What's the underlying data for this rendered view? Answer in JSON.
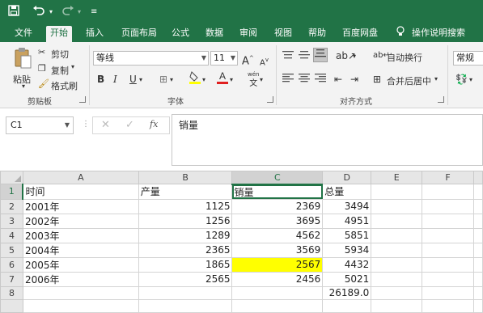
{
  "colors": {
    "brand": "#217346",
    "highlight": "#ffff00"
  },
  "titlebar": {
    "icons": [
      "save-icon",
      "undo-icon",
      "redo-icon",
      "customize-icon"
    ]
  },
  "tabs": [
    "文件",
    "开始",
    "插入",
    "页面布局",
    "公式",
    "数据",
    "审阅",
    "视图",
    "帮助",
    "百度网盘",
    "操作说明搜索"
  ],
  "ribbon": {
    "clipboard": {
      "paste": "粘贴",
      "cut": "剪切",
      "copy": "复制",
      "format_painter": "格式刷",
      "label": "剪贴板"
    },
    "font": {
      "name": "等线",
      "size": "11",
      "grow": "A",
      "shrink": "A",
      "bold": "B",
      "italic": "I",
      "underline": "U",
      "phonetic": "wén",
      "label": "字体"
    },
    "alignment": {
      "wrap": "自动换行",
      "merge": "合并后居中",
      "label": "对齐方式"
    },
    "number": {
      "format": "常规"
    }
  },
  "formula": {
    "name_box": "C1",
    "content": "销量",
    "fx": "fx"
  },
  "sheet": {
    "columns": [
      "A",
      "B",
      "C",
      "D",
      "E",
      "F"
    ],
    "rows": [
      {
        "n": "1",
        "cells": [
          "时间",
          "产量",
          "销量",
          "总量",
          "",
          ""
        ]
      },
      {
        "n": "2",
        "cells": [
          "2001年",
          "1125",
          "2369",
          "3494",
          "",
          ""
        ]
      },
      {
        "n": "3",
        "cells": [
          "2002年",
          "1256",
          "3695",
          "4951",
          "",
          ""
        ]
      },
      {
        "n": "4",
        "cells": [
          "2003年",
          "1289",
          "4562",
          "5851",
          "",
          ""
        ]
      },
      {
        "n": "5",
        "cells": [
          "2004年",
          "2365",
          "3569",
          "5934",
          "",
          ""
        ]
      },
      {
        "n": "6",
        "cells": [
          "2005年",
          "1865",
          "2567",
          "4432",
          "",
          ""
        ]
      },
      {
        "n": "7",
        "cells": [
          "2006年",
          "2565",
          "2456",
          "5021",
          "",
          ""
        ]
      },
      {
        "n": "8",
        "cells": [
          "",
          "",
          "",
          "26189.0",
          "",
          ""
        ]
      }
    ]
  }
}
